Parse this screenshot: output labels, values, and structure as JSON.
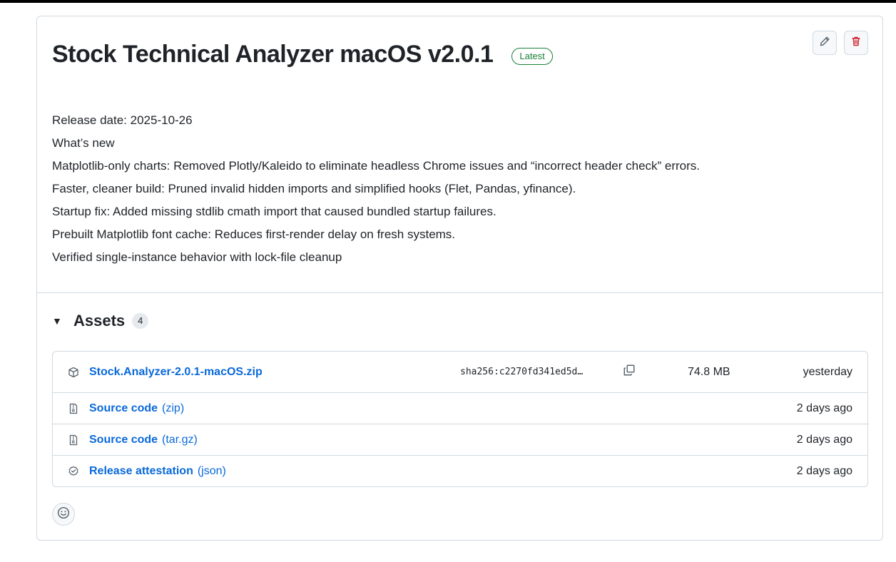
{
  "release": {
    "title": "Stock Technical Analyzer macOS v2.0.1",
    "badge": "Latest",
    "notes": [
      "Release date: 2025-10-26",
      "What’s new",
      "Matplotlib-only charts: Removed Plotly/Kaleido to eliminate headless Chrome issues and “incorrect header check” errors.",
      "Faster, cleaner build: Pruned invalid hidden imports and simplified hooks (Flet, Pandas, yfinance).",
      "Startup fix: Added missing stdlib cmath import that caused bundled startup failures.",
      "Prebuilt Matplotlib font cache: Reduces first-render delay on fresh systems.",
      "Verified single-instance behavior with lock-file cleanup"
    ]
  },
  "actions": {
    "edit_icon": "pencil-icon",
    "delete_icon": "trash-icon"
  },
  "assets": {
    "title": "Assets",
    "count": "4",
    "items": [
      {
        "icon": "package-icon",
        "name": "Stock.Analyzer-2.0.1-macOS.zip",
        "suffix": "",
        "sha": "sha256:c2270fd341ed5d…",
        "size": "74.8 MB",
        "date": "yesterday"
      },
      {
        "icon": "file-zip-icon",
        "name": "Source code",
        "suffix": "(zip)",
        "date": "2 days ago"
      },
      {
        "icon": "file-zip-icon",
        "name": "Source code",
        "suffix": "(tar.gz)",
        "date": "2 days ago"
      },
      {
        "icon": "verified-icon",
        "name": "Release attestation",
        "suffix": "(json)",
        "date": "2 days ago"
      }
    ]
  },
  "reactions": {
    "icon": "smiley-icon"
  },
  "colors": {
    "link": "#0969da",
    "latest_badge": "#1a7f37",
    "delete": "#cf222e",
    "border": "#d1d9e0"
  }
}
